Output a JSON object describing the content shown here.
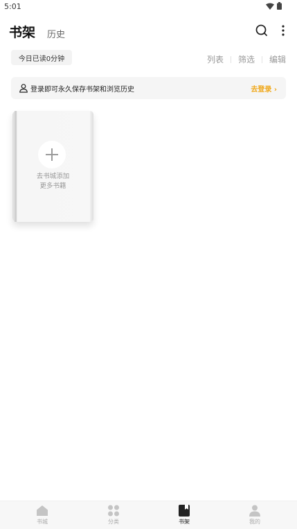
{
  "status_bar": {
    "time": "5:01"
  },
  "header": {
    "tab_shelf": "书架",
    "tab_history": "历史"
  },
  "toolbar": {
    "reading_time": "今日已读0分钟",
    "list": "列表",
    "filter": "筛选",
    "edit": "编辑"
  },
  "login_banner": {
    "text": "登录即可永久保存书架和浏览历史",
    "link": "去登录 ›"
  },
  "add_card": {
    "line1": "去书城添加",
    "line2": "更多书籍"
  },
  "bottom_nav": {
    "items": [
      {
        "label": "书城",
        "icon": "home-icon"
      },
      {
        "label": "分类",
        "icon": "category-icon"
      },
      {
        "label": "书架",
        "icon": "bookshelf-icon",
        "active": true
      },
      {
        "label": "我的",
        "icon": "profile-icon"
      }
    ]
  },
  "colors": {
    "accent": "#f0a81a",
    "active_nav": "#222222",
    "inactive_nav": "#c4c4c4"
  }
}
